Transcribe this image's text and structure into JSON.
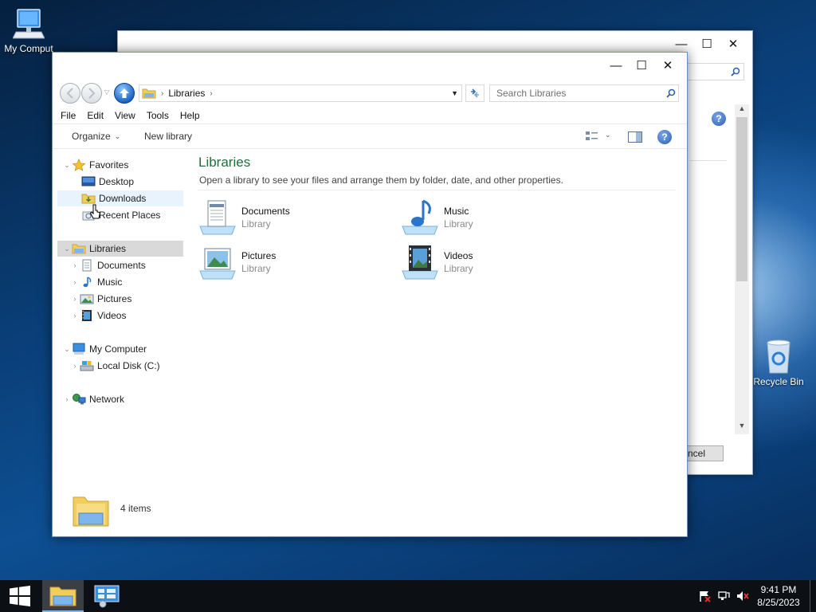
{
  "desktop": {
    "my_computer_label": "My Comput",
    "recycle_bin_label": "Recycle Bin"
  },
  "background_window": {
    "cancel_label": "ncel",
    "minimize": "—",
    "maximize": "☐",
    "close": "✕"
  },
  "window": {
    "minimize": "—",
    "maximize": "☐",
    "close": "✕",
    "address_path": [
      "Libraries"
    ],
    "search_placeholder": "Search Libraries",
    "menu": [
      "File",
      "Edit",
      "View",
      "Tools",
      "Help"
    ],
    "toolbar": {
      "organize_label": "Organize",
      "new_library_label": "New library"
    },
    "nav": {
      "favorites": "Favorites",
      "favorites_items": [
        "Desktop",
        "Downloads",
        "Recent Places"
      ],
      "libraries": "Libraries",
      "libraries_items": [
        "Documents",
        "Music",
        "Pictures",
        "Videos"
      ],
      "my_computer": "My Computer",
      "computer_items": [
        "Local Disk (C:)"
      ],
      "network": "Network"
    },
    "content": {
      "title": "Libraries",
      "description": "Open a library to see your files and arrange them by folder, date, and other properties.",
      "items": [
        {
          "name": "Documents",
          "type": "Library"
        },
        {
          "name": "Music",
          "type": "Library"
        },
        {
          "name": "Pictures",
          "type": "Library"
        },
        {
          "name": "Videos",
          "type": "Library"
        }
      ]
    },
    "details": {
      "item_count": "4 items"
    }
  },
  "taskbar": {
    "time": "9:41 PM",
    "date": "8/25/2023"
  },
  "colors": {
    "title_green": "#1f6e3c",
    "selection_gray": "#d9d9d9",
    "hover_blue": "#e8f3fd"
  }
}
